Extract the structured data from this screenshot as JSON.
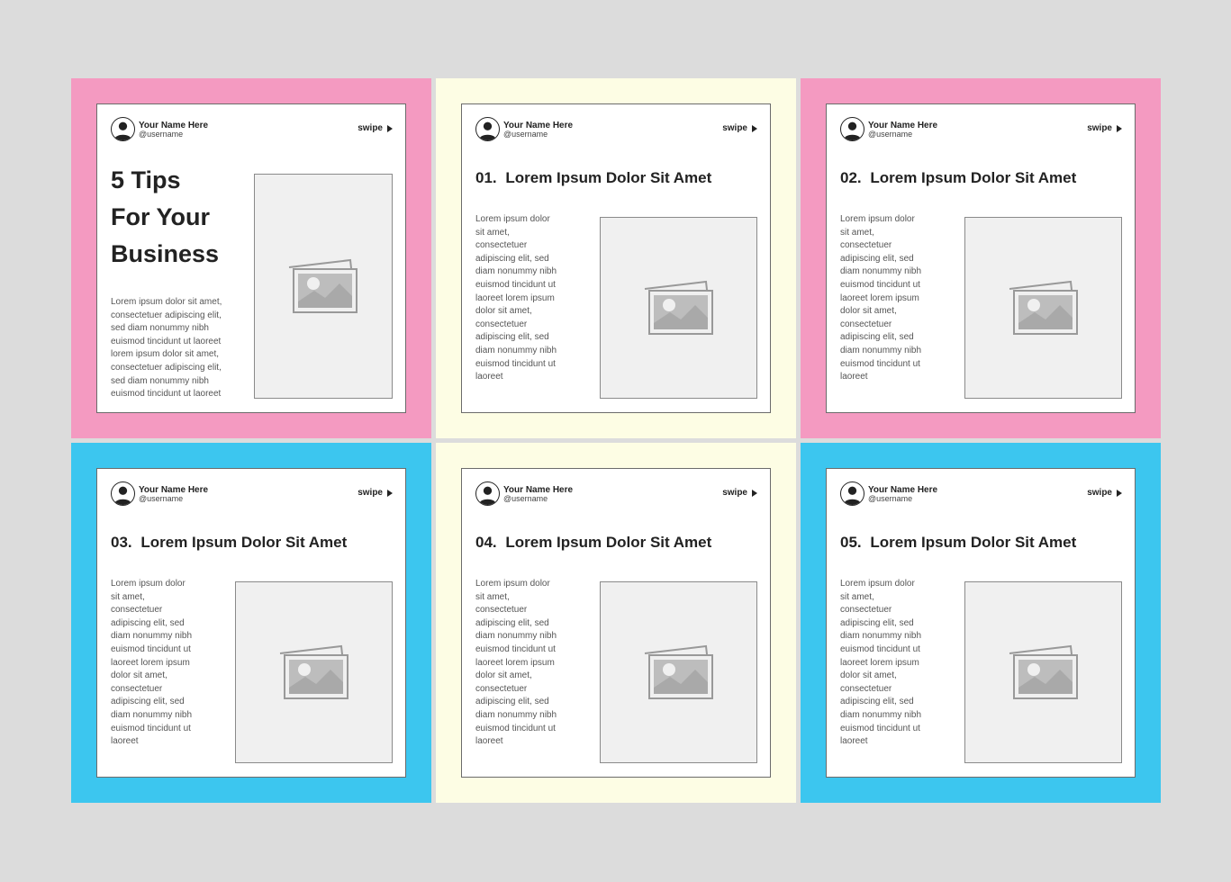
{
  "colors": {
    "pink": "#f49ac1",
    "yellow": "#fdfde4",
    "blue": "#3cc6ef",
    "page": "#dcdcdc"
  },
  "profile": {
    "name": "Your Name Here",
    "username": "@username"
  },
  "swipe_label": "swipe",
  "cover": {
    "title_lines": [
      "5 Tips",
      "For Your",
      "Business"
    ],
    "body": "Lorem ipsum dolor sit amet, consectetuer adipiscing elit, sed diam nonummy nibh euismod tincidunt ut laoreet lorem ipsum dolor sit amet, consectetuer adipiscing elit, sed diam nonummy nibh euismod tincidunt ut laoreet"
  },
  "slides": [
    {
      "number": "01.",
      "title": "Lorem Ipsum Dolor Sit Amet"
    },
    {
      "number": "02.",
      "title": "Lorem Ipsum Dolor Sit Amet"
    },
    {
      "number": "03.",
      "title": "Lorem Ipsum Dolor Sit Amet"
    },
    {
      "number": "04.",
      "title": "Lorem Ipsum Dolor Sit Amet"
    },
    {
      "number": "05.",
      "title": "Lorem Ipsum Dolor Sit Amet"
    }
  ],
  "slide_body": "Lorem ipsum dolor sit amet, consectetuer adipiscing elit, sed diam nonummy nibh euismod tincidunt ut laoreet lorem ipsum dolor sit amet, consectetuer adipiscing elit, sed diam nonummy nibh euismod tincidunt ut laoreet",
  "icons": {
    "avatar": "user-avatar-icon",
    "swipe": "play-arrow-icon",
    "image": "image-placeholder-icon"
  }
}
